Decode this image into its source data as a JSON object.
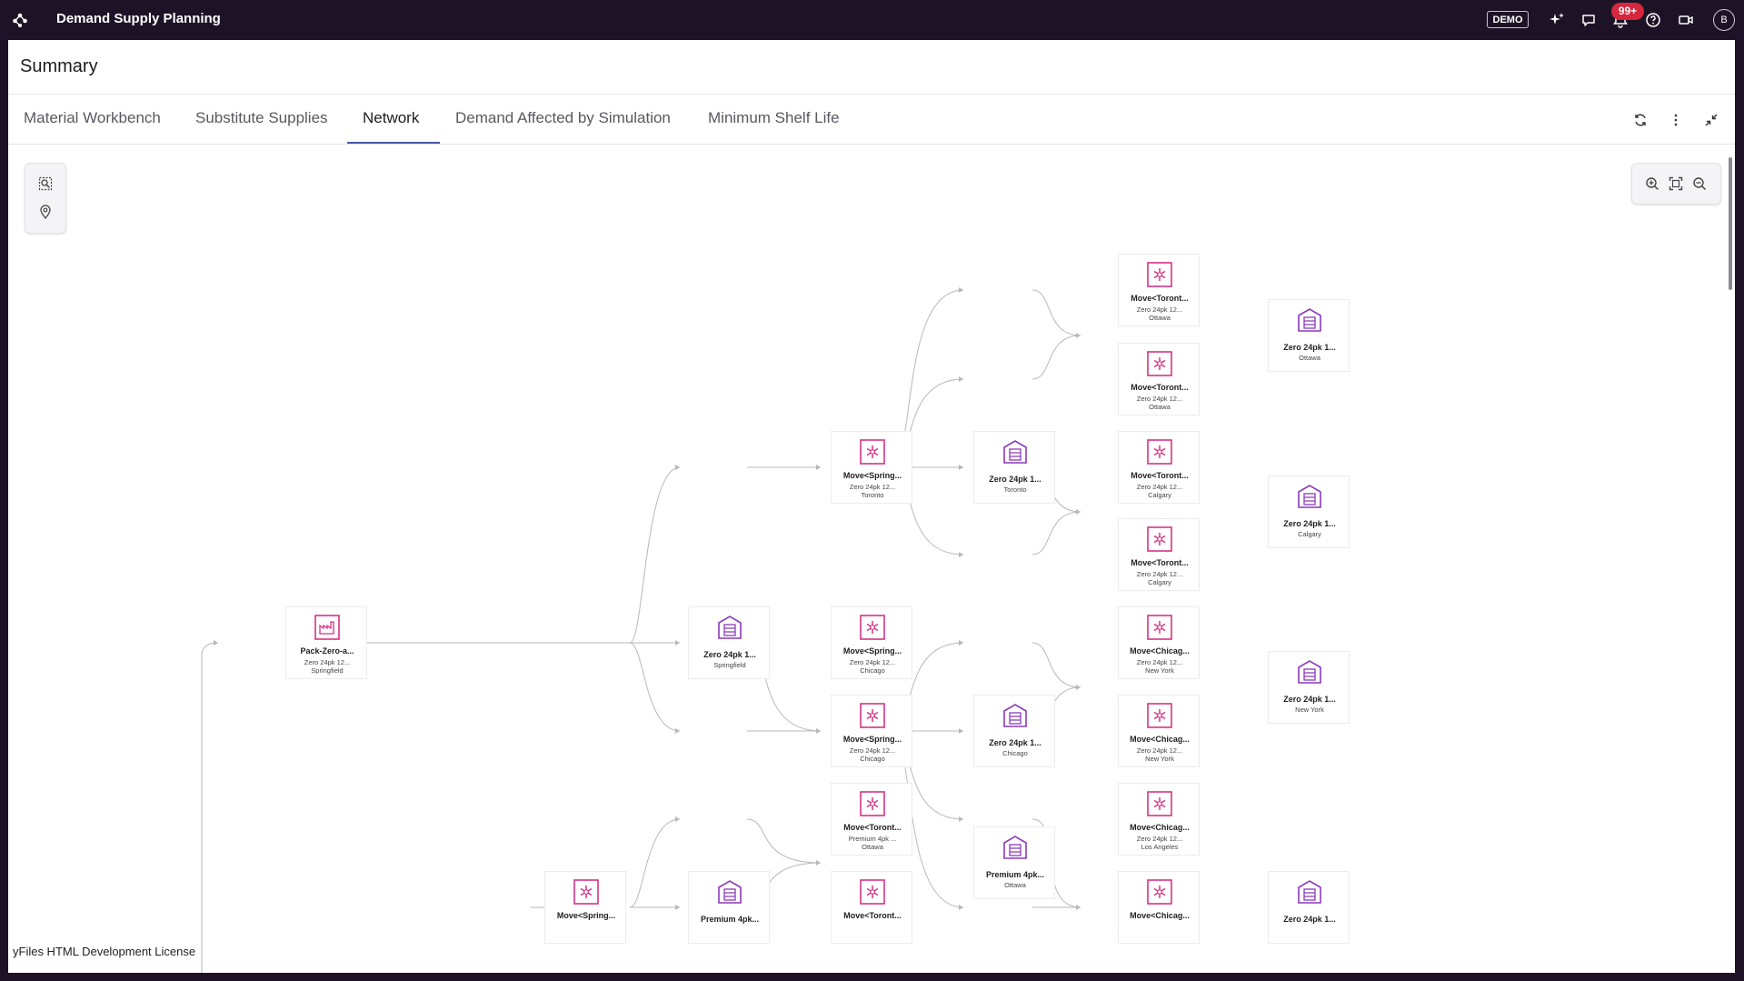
{
  "app": {
    "title": "Demand Supply Planning",
    "demo_badge": "DEMO",
    "notification_count": "99+",
    "avatar_initial": "B",
    "colors": {
      "topbar": "#1e1326",
      "accent": "#4a57a6",
      "transport_icon": "#d63384",
      "warehouse_icon": "#8a3ab9",
      "badge": "#d7263d"
    }
  },
  "panel": {
    "title": "Summary"
  },
  "tabs": [
    {
      "label": "Material Workbench",
      "active": false
    },
    {
      "label": "Substitute Supplies",
      "active": false
    },
    {
      "label": "Network",
      "active": true
    },
    {
      "label": "Demand Affected by Simulation",
      "active": false
    },
    {
      "label": "Minimum Shelf Life",
      "active": false
    }
  ],
  "license": "yFiles HTML Development License",
  "nodes": [
    {
      "id": "pack",
      "kind": "factory",
      "l1": "Pack-Zero-a...",
      "l2": "Zero 24pk 12...",
      "l3": "Springfield"
    },
    {
      "id": "wh-springfield",
      "kind": "warehouse",
      "l1": "Zero 24pk 1...",
      "l2": "Springfield"
    },
    {
      "id": "mv-spr-tor",
      "kind": "transport",
      "l1": "Move<Spring...",
      "l2": "Zero 24pk 12...",
      "l3": "Toronto"
    },
    {
      "id": "mv-spr-chi-1",
      "kind": "transport",
      "l1": "Move<Spring...",
      "l2": "Zero 24pk 12...",
      "l3": "Chicago"
    },
    {
      "id": "mv-spr-chi-2",
      "kind": "transport",
      "l1": "Move<Spring...",
      "l2": "Zero 24pk 12...",
      "l3": "Chicago"
    },
    {
      "id": "mv-tor-ott-p",
      "kind": "transport",
      "l1": "Move<Toront...",
      "l2": "Premium 4pk ...",
      "l3": "Ottawa"
    },
    {
      "id": "mv-tor-bottom",
      "kind": "transport",
      "l1": "Move<Toront...",
      "l2": "",
      "l3": ""
    },
    {
      "id": "wh-toronto",
      "kind": "warehouse",
      "l1": "Zero 24pk 1...",
      "l2": "Toronto"
    },
    {
      "id": "wh-chicago",
      "kind": "warehouse",
      "l1": "Zero 24pk 1...",
      "l2": "Chicago"
    },
    {
      "id": "wh-ottawa-p",
      "kind": "warehouse",
      "l1": "Premium 4pk...",
      "l2": "Ottawa"
    },
    {
      "id": "mv-tor-ott-1",
      "kind": "transport",
      "l1": "Move<Toront...",
      "l2": "Zero 24pk 12...",
      "l3": "Ottawa"
    },
    {
      "id": "mv-tor-ott-2",
      "kind": "transport",
      "l1": "Move<Toront...",
      "l2": "Zero 24pk 12...",
      "l3": "Ottawa"
    },
    {
      "id": "mv-tor-cal-1",
      "kind": "transport",
      "l1": "Move<Toront...",
      "l2": "Zero 24pk 12...",
      "l3": "Calgary"
    },
    {
      "id": "mv-tor-cal-2",
      "kind": "transport",
      "l1": "Move<Toront...",
      "l2": "Zero 24pk 12...",
      "l3": "Calgary"
    },
    {
      "id": "mv-chi-ny-1",
      "kind": "transport",
      "l1": "Move<Chicag...",
      "l2": "Zero 24pk 12...",
      "l3": "New York"
    },
    {
      "id": "mv-chi-ny-2",
      "kind": "transport",
      "l1": "Move<Chicag...",
      "l2": "Zero 24pk 12...",
      "l3": "New York"
    },
    {
      "id": "mv-chi-la",
      "kind": "transport",
      "l1": "Move<Chicag...",
      "l2": "Zero 24pk 12...",
      "l3": "Los Angeles"
    },
    {
      "id": "mv-chi-bottom",
      "kind": "transport",
      "l1": "Move<Chicag...",
      "l2": "",
      "l3": ""
    },
    {
      "id": "wh-ottawa",
      "kind": "warehouse",
      "l1": "Zero 24pk 1...",
      "l2": "Ottawa"
    },
    {
      "id": "wh-calgary",
      "kind": "warehouse",
      "l1": "Zero 24pk 1...",
      "l2": "Calgary"
    },
    {
      "id": "wh-newyork",
      "kind": "warehouse",
      "l1": "Zero 24pk 1...",
      "l2": "New York"
    },
    {
      "id": "wh-bottom-right",
      "kind": "warehouse",
      "l1": "Zero 24pk 1...",
      "l2": ""
    },
    {
      "id": "mv-spr-bottom",
      "kind": "transport",
      "l1": "Move<Spring...",
      "l2": "",
      "l3": ""
    },
    {
      "id": "wh-premium-bottom",
      "kind": "warehouse",
      "l1": "Premium 4pk...",
      "l2": ""
    }
  ]
}
